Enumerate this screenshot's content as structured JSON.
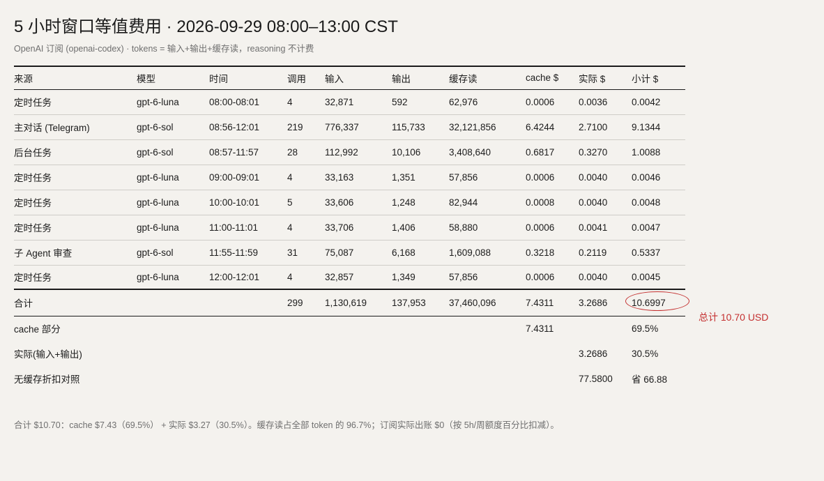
{
  "title": "5 小时窗口等值费用 · 2026-09-29 08:00–13:00 CST",
  "subtitle": "OpenAI 订阅 (openai-codex) · tokens = 输入+输出+缓存读，reasoning 不计费",
  "columns": [
    "来源",
    "模型",
    "时间",
    "调用",
    "输入",
    "输出",
    "缓存读",
    "cache $",
    "实际 $",
    "小计 $"
  ],
  "rows": [
    [
      "定时任务",
      "gpt-6-luna",
      "08:00-08:01",
      "4",
      "32,871",
      "592",
      "62,976",
      "0.0006",
      "0.0036",
      "0.0042"
    ],
    [
      "主对话 (Telegram)",
      "gpt-6-sol",
      "08:56-12:01",
      "219",
      "776,337",
      "115,733",
      "32,121,856",
      "6.4244",
      "2.7100",
      "9.1344"
    ],
    [
      "后台任务",
      "gpt-6-sol",
      "08:57-11:57",
      "28",
      "112,992",
      "10,106",
      "3,408,640",
      "0.6817",
      "0.3270",
      "1.0088"
    ],
    [
      "定时任务",
      "gpt-6-luna",
      "09:00-09:01",
      "4",
      "33,163",
      "1,351",
      "57,856",
      "0.0006",
      "0.0040",
      "0.0046"
    ],
    [
      "定时任务",
      "gpt-6-luna",
      "10:00-10:01",
      "5",
      "33,606",
      "1,248",
      "82,944",
      "0.0008",
      "0.0040",
      "0.0048"
    ],
    [
      "定时任务",
      "gpt-6-luna",
      "11:00-11:01",
      "4",
      "33,706",
      "1,406",
      "58,880",
      "0.0006",
      "0.0041",
      "0.0047"
    ],
    [
      "子 Agent 审查",
      "gpt-6-sol",
      "11:55-11:59",
      "31",
      "75,087",
      "6,168",
      "1,609,088",
      "0.3218",
      "0.2119",
      "0.5337"
    ],
    [
      "定时任务",
      "gpt-6-luna",
      "12:00-12:01",
      "4",
      "32,857",
      "1,349",
      "57,856",
      "0.0006",
      "0.0040",
      "0.0045"
    ]
  ],
  "total": {
    "label": "合计",
    "calls": "299",
    "input": "1,130,619",
    "output": "137,953",
    "cache_read": "37,460,096",
    "cache_usd": "7.4311",
    "actual_usd": "3.2686",
    "subtotal_usd": "10.6997"
  },
  "total_note": "总计 10.70 USD",
  "breakdown": [
    {
      "label": "cache 部分",
      "cache_usd": "7.4311",
      "actual_usd": "",
      "subtotal": "69.5%"
    },
    {
      "label": "实际(输入+输出)",
      "cache_usd": "",
      "actual_usd": "3.2686",
      "subtotal": "30.5%"
    },
    {
      "label": "无缓存折扣对照",
      "cache_usd": "",
      "actual_usd": "77.5800",
      "subtotal": "省 66.88"
    }
  ],
  "footnote": "合计 $10.70：cache $7.43（69.5%） + 实际 $3.27（30.5%）。缓存读占全部 token 的 96.7%；订阅实际出账 $0（按 5h/周额度百分比扣减）。",
  "colors": {
    "highlight": "#c43030",
    "background": "#f4f2ee"
  }
}
